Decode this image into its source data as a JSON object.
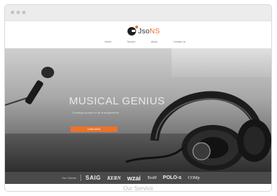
{
  "browser": {
    "dots": 3
  },
  "header": {
    "logo": {
      "icon": "headphone-logo-icon",
      "text_main": "Jso",
      "text_accent": "NS"
    },
    "nav": [
      "Home",
      "Service",
      "About",
      "Contact Us"
    ]
  },
  "hero": {
    "headline": "MUSICAL GENIUS",
    "subline": "Creating sounds for all arrangements",
    "cta_label": "Learn More"
  },
  "clients": {
    "label": "Our Clients",
    "logos": [
      "SAIG",
      "KERN",
      "wzai",
      "TosM",
      "POLO-s",
      "COMp"
    ]
  },
  "services": {
    "title": "Our Service"
  },
  "colors": {
    "accent": "#e8742c",
    "strip": "#4a4a4a"
  }
}
